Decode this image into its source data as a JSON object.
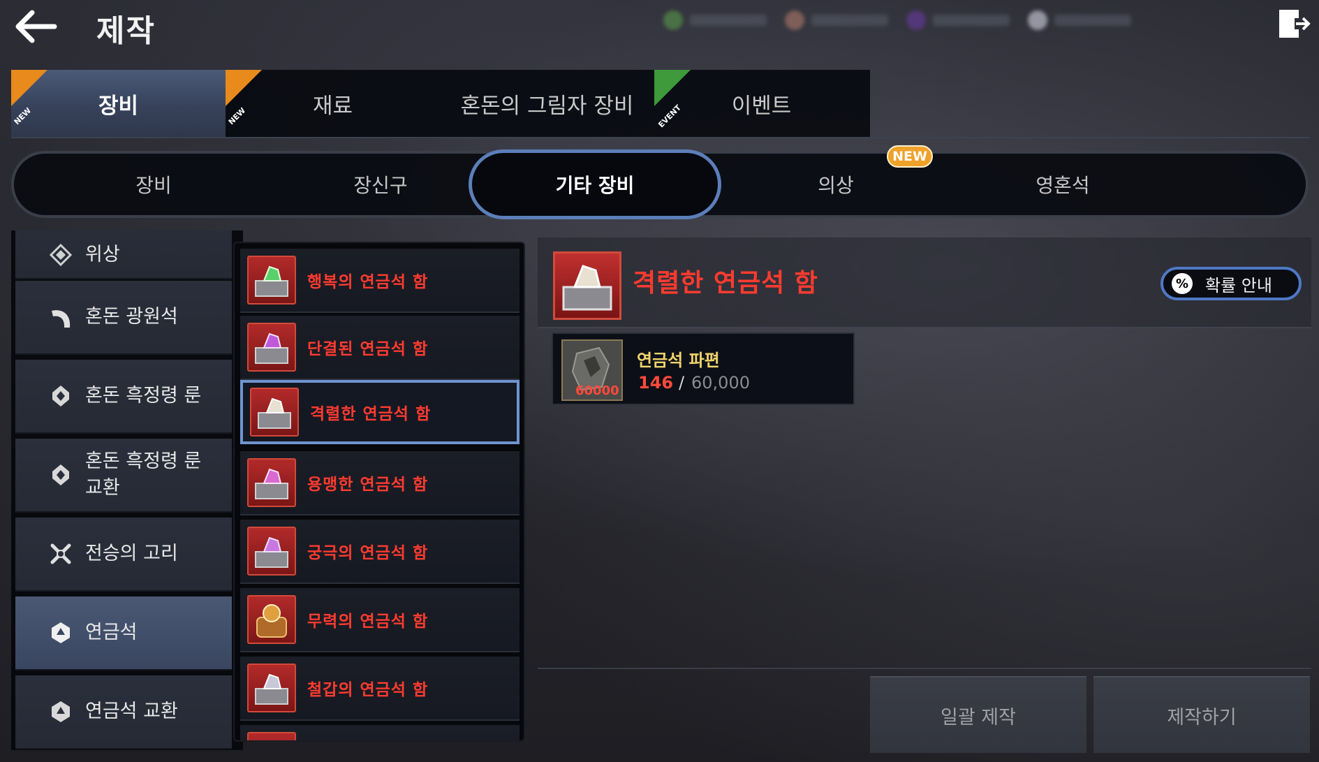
{
  "header": {
    "title": "제작",
    "back_icon": "arrow-left-icon",
    "exit_icon": "exit-door-icon"
  },
  "main_tabs": [
    {
      "label": "장비",
      "badge": "NEW",
      "active": true
    },
    {
      "label": "재료",
      "badge": "NEW",
      "active": false
    },
    {
      "label": "혼돈의 그림자 장비",
      "badge": "",
      "active": false
    },
    {
      "label": "이벤트",
      "badge": "EVENT",
      "active": false
    }
  ],
  "sub_tabs": [
    {
      "label": "장비",
      "active": false
    },
    {
      "label": "장신구",
      "active": false
    },
    {
      "label": "기타 장비",
      "active": true
    },
    {
      "label": "의상",
      "active": false,
      "badge": "NEW"
    },
    {
      "label": "영혼석",
      "active": false
    }
  ],
  "categories": [
    {
      "label": "위상",
      "icon": "emblem-icon",
      "active": false
    },
    {
      "label": "혼돈 광원석",
      "icon": "crescent-stone-icon",
      "active": false
    },
    {
      "label": "혼돈 흑정령 룬",
      "icon": "rune-icon",
      "active": false
    },
    {
      "label": "혼돈 흑정령 룬\n교환",
      "icon": "rune-exchange-icon",
      "active": false
    },
    {
      "label": "전승의 고리",
      "icon": "crossed-swords-icon",
      "active": false
    },
    {
      "label": "연금석",
      "icon": "alchemy-stone-icon",
      "active": true
    },
    {
      "label": "연금석 교환",
      "icon": "alchemy-exchange-icon",
      "active": false
    }
  ],
  "items": [
    {
      "name": "행복의 연금석 함",
      "gem": "#5ad06a",
      "selected": false
    },
    {
      "name": "단결된 연금석 함",
      "gem": "#c05ad8",
      "selected": false
    },
    {
      "name": "격렬한 연금석 함",
      "gem": "#e8e0d0",
      "selected": true
    },
    {
      "name": "용맹한 연금석 함",
      "gem": "#d86ad0",
      "selected": false
    },
    {
      "name": "궁극의 연금석 함",
      "gem": "#c878e0",
      "selected": false
    },
    {
      "name": "무력의 연금석 함",
      "gem": "#e0a040",
      "selected": false
    },
    {
      "name": "철갑의 연금석 함",
      "gem": "#c8c8d8",
      "selected": false
    }
  ],
  "detail": {
    "name": "격렬한 연금석 함",
    "probability_label": "확률 안내",
    "probability_icon": "percent-icon"
  },
  "material": {
    "name": "연금석 파편",
    "have": "146",
    "separator": "/",
    "need": "60,000",
    "count_badge": "60000"
  },
  "actions": {
    "bulk_craft": "일괄 제작",
    "craft": "제작하기"
  },
  "colors": {
    "accent_blue": "#5c7fb9",
    "item_red": "#ff3b2f",
    "material_gold": "#f1d46a",
    "badge_orange": "#e88a1c",
    "badge_green": "#3e9a3a"
  }
}
